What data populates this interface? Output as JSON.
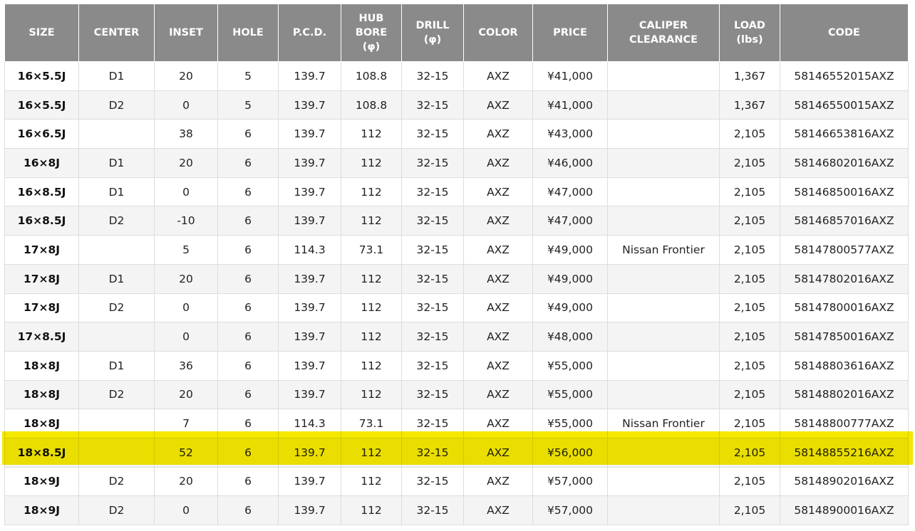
{
  "colors": {
    "header_bg": "#8a8a8a",
    "header_text": "#ffffff",
    "row_alt_bg": "#f4f4f4",
    "highlight": "#f4e800"
  },
  "table": {
    "headers": [
      [
        "SIZE"
      ],
      [
        "CENTER"
      ],
      [
        "INSET"
      ],
      [
        "HOLE"
      ],
      [
        "P.C.D."
      ],
      [
        "HUB",
        "BORE",
        "(φ)"
      ],
      [
        "DRILL",
        "(φ)"
      ],
      [
        "COLOR"
      ],
      [
        "PRICE"
      ],
      [
        "CALIPER",
        "CLEARANCE"
      ],
      [
        "LOAD",
        "(lbs)"
      ],
      [
        "CODE"
      ]
    ],
    "rows": [
      [
        "16×5.5J",
        "D1",
        "20",
        "5",
        "139.7",
        "108.8",
        "32-15",
        "AXZ",
        "¥41,000",
        "",
        "1,367",
        "58146552015AXZ"
      ],
      [
        "16×5.5J",
        "D2",
        "0",
        "5",
        "139.7",
        "108.8",
        "32-15",
        "AXZ",
        "¥41,000",
        "",
        "1,367",
        "58146550015AXZ"
      ],
      [
        "16×6.5J",
        "",
        "38",
        "6",
        "139.7",
        "112",
        "32-15",
        "AXZ",
        "¥43,000",
        "",
        "2,105",
        "58146653816AXZ"
      ],
      [
        "16×8J",
        "D1",
        "20",
        "6",
        "139.7",
        "112",
        "32-15",
        "AXZ",
        "¥46,000",
        "",
        "2,105",
        "58146802016AXZ"
      ],
      [
        "16×8.5J",
        "D1",
        "0",
        "6",
        "139.7",
        "112",
        "32-15",
        "AXZ",
        "¥47,000",
        "",
        "2,105",
        "58146850016AXZ"
      ],
      [
        "16×8.5J",
        "D2",
        "-10",
        "6",
        "139.7",
        "112",
        "32-15",
        "AXZ",
        "¥47,000",
        "",
        "2,105",
        "58146857016AXZ"
      ],
      [
        "17×8J",
        "",
        "5",
        "6",
        "114.3",
        "73.1",
        "32-15",
        "AXZ",
        "¥49,000",
        "Nissan Frontier",
        "2,105",
        "58147800577AXZ"
      ],
      [
        "17×8J",
        "D1",
        "20",
        "6",
        "139.7",
        "112",
        "32-15",
        "AXZ",
        "¥49,000",
        "",
        "2,105",
        "58147802016AXZ"
      ],
      [
        "17×8J",
        "D2",
        "0",
        "6",
        "139.7",
        "112",
        "32-15",
        "AXZ",
        "¥49,000",
        "",
        "2,105",
        "58147800016AXZ"
      ],
      [
        "17×8.5J",
        "",
        "0",
        "6",
        "139.7",
        "112",
        "32-15",
        "AXZ",
        "¥48,000",
        "",
        "2,105",
        "58147850016AXZ"
      ],
      [
        "18×8J",
        "D1",
        "36",
        "6",
        "139.7",
        "112",
        "32-15",
        "AXZ",
        "¥55,000",
        "",
        "2,105",
        "58148803616AXZ"
      ],
      [
        "18×8J",
        "D2",
        "20",
        "6",
        "139.7",
        "112",
        "32-15",
        "AXZ",
        "¥55,000",
        "",
        "2,105",
        "58148802016AXZ"
      ],
      [
        "18×8J",
        "",
        "7",
        "6",
        "114.3",
        "73.1",
        "32-15",
        "AXZ",
        "¥55,000",
        "Nissan Frontier",
        "2,105",
        "58148800777AXZ"
      ],
      [
        "18×8.5J",
        "",
        "52",
        "6",
        "139.7",
        "112",
        "32-15",
        "AXZ",
        "¥56,000",
        "",
        "2,105",
        "58148855216AXZ"
      ],
      [
        "18×9J",
        "D2",
        "20",
        "6",
        "139.7",
        "112",
        "32-15",
        "AXZ",
        "¥57,000",
        "",
        "2,105",
        "58148902016AXZ"
      ],
      [
        "18×9J",
        "D2",
        "0",
        "6",
        "139.7",
        "112",
        "32-15",
        "AXZ",
        "¥57,000",
        "",
        "2,105",
        "58148900016AXZ"
      ]
    ],
    "highlighted_row": 13
  }
}
